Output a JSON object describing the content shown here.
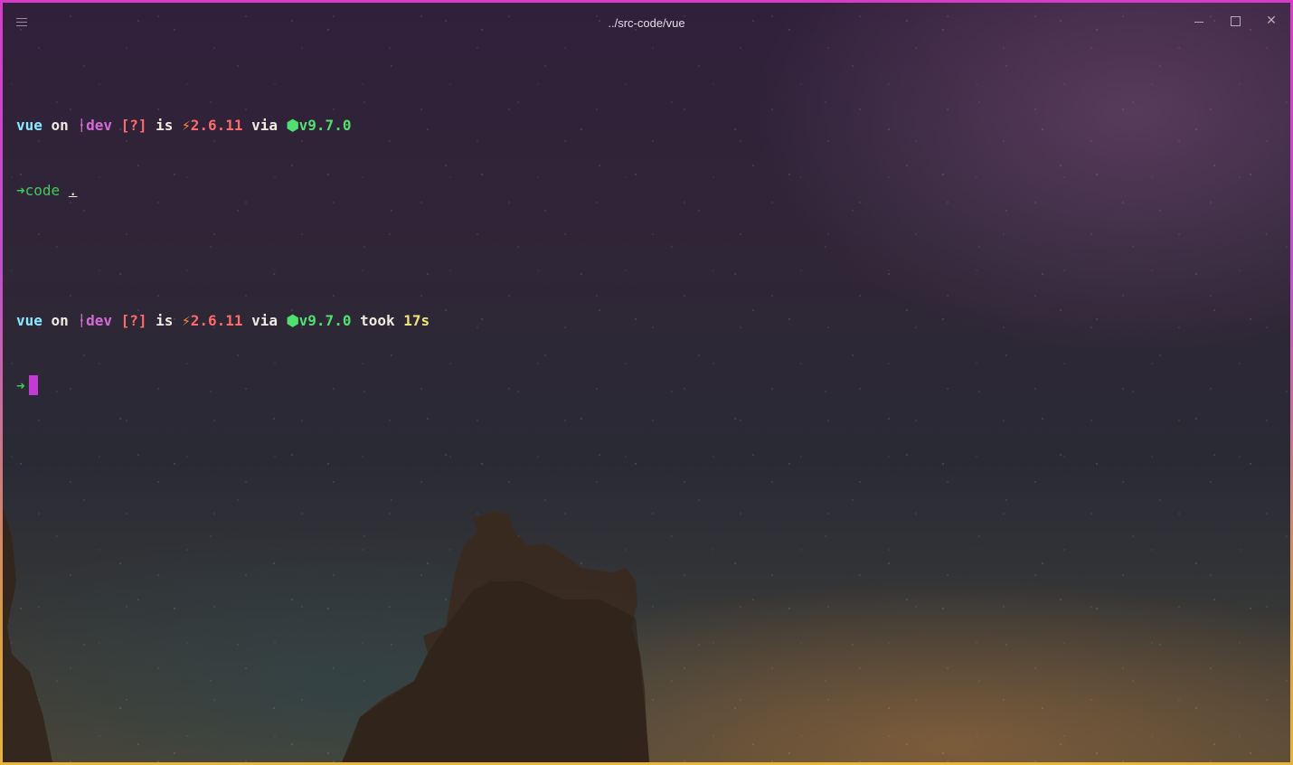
{
  "window": {
    "title": "../src-code/vue",
    "controls": {
      "minimize": "–",
      "maximize": "☐",
      "close": "✕"
    }
  },
  "terminal": {
    "prompt1": {
      "dir": "vue",
      "on": "on",
      "branch_icon": "",
      "branch": "dev",
      "status": "[?]",
      "is": "is",
      "pkg_icon": "⚡",
      "pkg_version": "2.6.11",
      "via": "via",
      "node_icon": "⬢",
      "node_version": "v9.7.0"
    },
    "command": {
      "arrow": "➜",
      "name": "code",
      "arg": "."
    },
    "prompt2": {
      "dir": "vue",
      "on": "on",
      "branch_icon": "",
      "branch": "dev",
      "status": "[?]",
      "is": "is",
      "pkg_icon": "⚡",
      "pkg_version": "2.6.11",
      "via": "via",
      "node_icon": "⬢",
      "node_version": "v9.7.0",
      "took": "took",
      "duration": "17s"
    },
    "input": {
      "arrow": "➜"
    }
  }
}
